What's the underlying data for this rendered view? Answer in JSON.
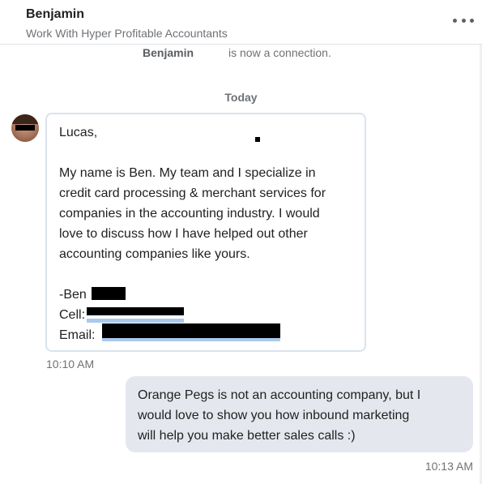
{
  "header": {
    "name": "Benjamin",
    "subtitle": "Work With Hyper Profitable Accountants",
    "more_icon": "more-horizontal-icon"
  },
  "conversation": {
    "connection_note": {
      "name": "Benjamin",
      "text": "is now a connection."
    },
    "day_label": "Today",
    "messages": [
      {
        "direction": "incoming",
        "lines": [
          "Lucas,",
          "",
          "My name is Ben. My team and I specialize in",
          "credit card processing & merchant services for",
          "companies in the accounting industry. I would",
          "love to discuss how I have helped out other",
          "accounting companies like yours.",
          "",
          "-Ben",
          "Cell:",
          "Email:"
        ],
        "time": "10:10 AM"
      },
      {
        "direction": "outgoing",
        "lines": [
          "Orange Pegs is not an accounting company, but I",
          "would love to show you how inbound marketing",
          "will help you make better sales calls :)"
        ],
        "time": "10:13 AM"
      }
    ]
  }
}
